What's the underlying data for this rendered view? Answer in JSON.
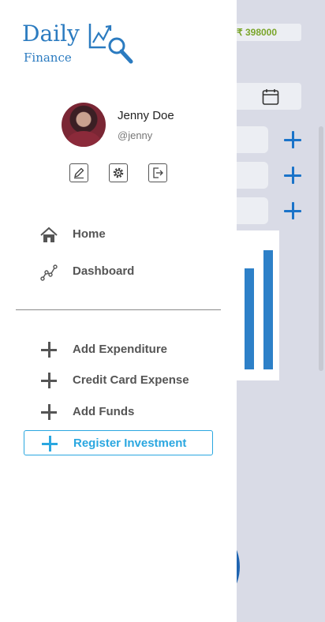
{
  "background": {
    "balance": "₹ 398000",
    "bar_levels": [
      0.78,
      0.92
    ]
  },
  "drawer": {
    "logo": {
      "word": "Daily",
      "sub": "Finance"
    },
    "user": {
      "name": "Jenny Doe",
      "handle": "@jenny"
    },
    "profile_actions": [
      {
        "icon": "edit-icon"
      },
      {
        "icon": "gear-icon"
      },
      {
        "icon": "logout-icon"
      }
    ],
    "nav": [
      {
        "label": "Home",
        "icon": "home-icon"
      },
      {
        "label": "Dashboard",
        "icon": "chart-line-icon"
      }
    ],
    "actions": [
      {
        "label": "Add Expenditure",
        "icon": "plus-icon",
        "active": false
      },
      {
        "label": "Credit Card Expense",
        "icon": "plus-icon",
        "active": false
      },
      {
        "label": "Add Funds",
        "icon": "plus-icon",
        "active": false
      },
      {
        "label": "Register Investment",
        "icon": "plus-icon",
        "active": true
      }
    ],
    "colors": {
      "brand": "#2b7bc0",
      "active": "#2aa7e0",
      "balance": "#7aa52a"
    }
  }
}
